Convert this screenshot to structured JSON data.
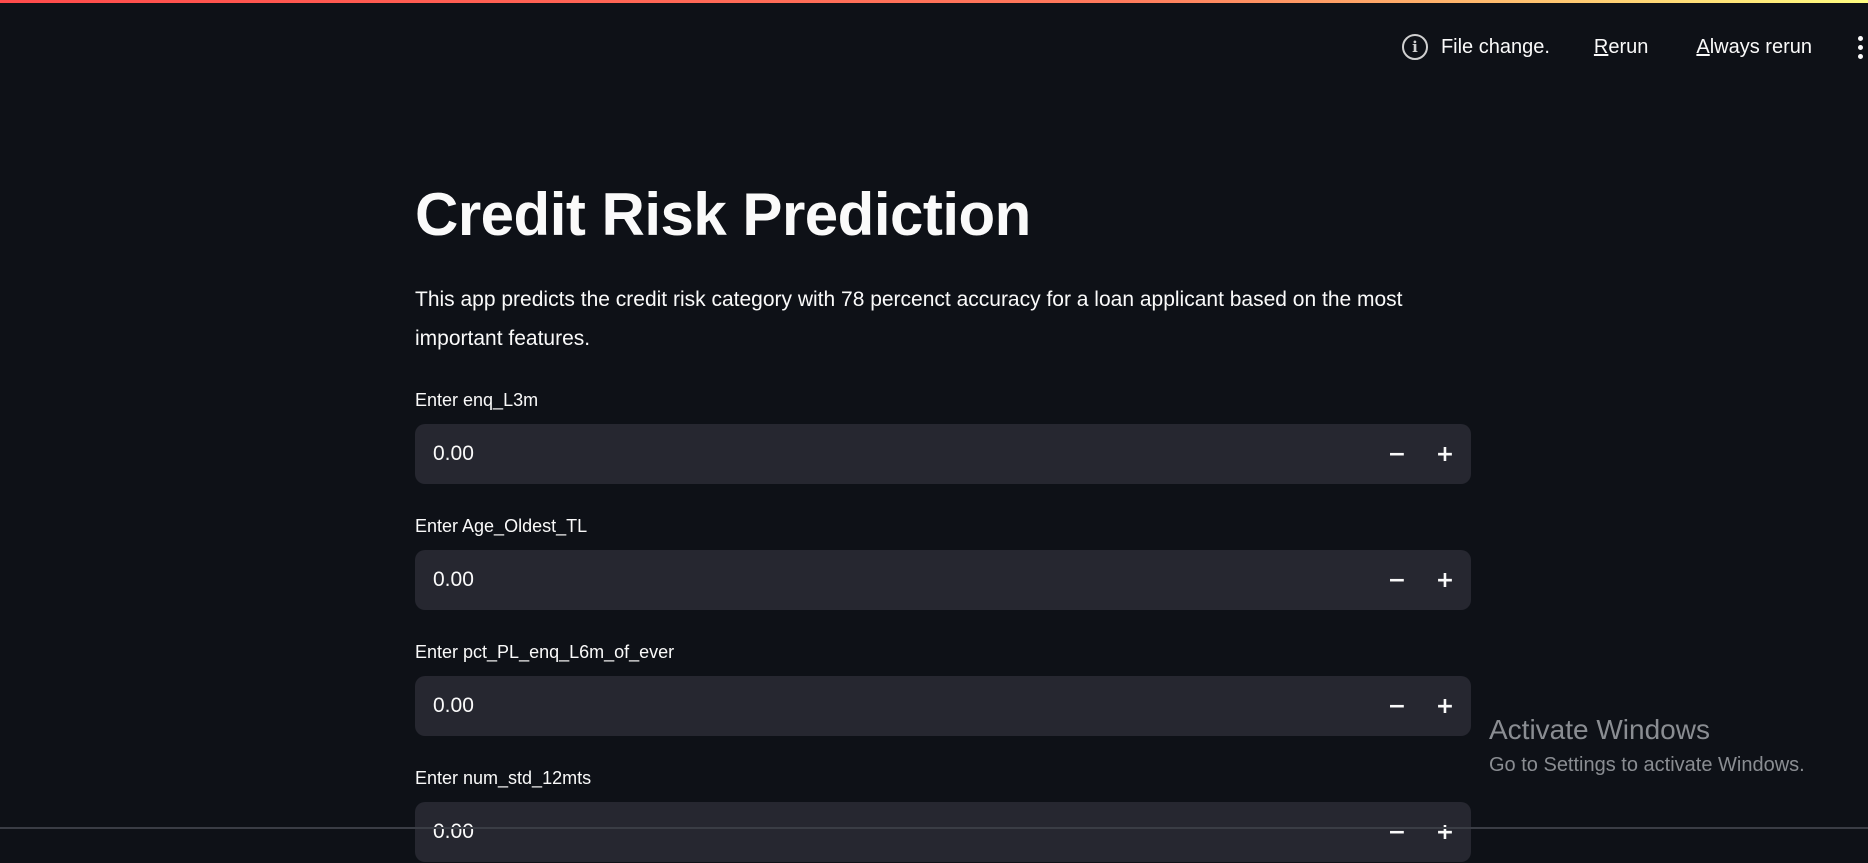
{
  "status": {
    "message": "File change.",
    "rerun_first": "R",
    "rerun_rest": "erun",
    "always_first": "A",
    "always_rest": "lways rerun",
    "info_icon": "info-circle-icon",
    "menu_icon": "kebab-menu-icon"
  },
  "app": {
    "title": "Credit Risk Prediction",
    "description": "This app predicts the credit risk category with 78 percenct accuracy for a loan applicant based on the most important features."
  },
  "fields": [
    {
      "label": "Enter enq_L3m",
      "value": "0.00",
      "minus": "−",
      "plus": "+"
    },
    {
      "label": "Enter Age_Oldest_TL",
      "value": "0.00",
      "minus": "−",
      "plus": "+"
    },
    {
      "label": "Enter pct_PL_enq_L6m_of_ever",
      "value": "0.00",
      "minus": "−",
      "plus": "+"
    },
    {
      "label": "Enter num_std_12mts",
      "value": "0.00",
      "minus": "−",
      "plus": "+"
    }
  ],
  "watermark": {
    "title": "Activate Windows",
    "subtitle": "Go to Settings to activate Windows."
  },
  "colors": {
    "background": "#0e1117",
    "input_background": "#262730",
    "text": "#fafafa",
    "watermark": "#8a8d92"
  }
}
